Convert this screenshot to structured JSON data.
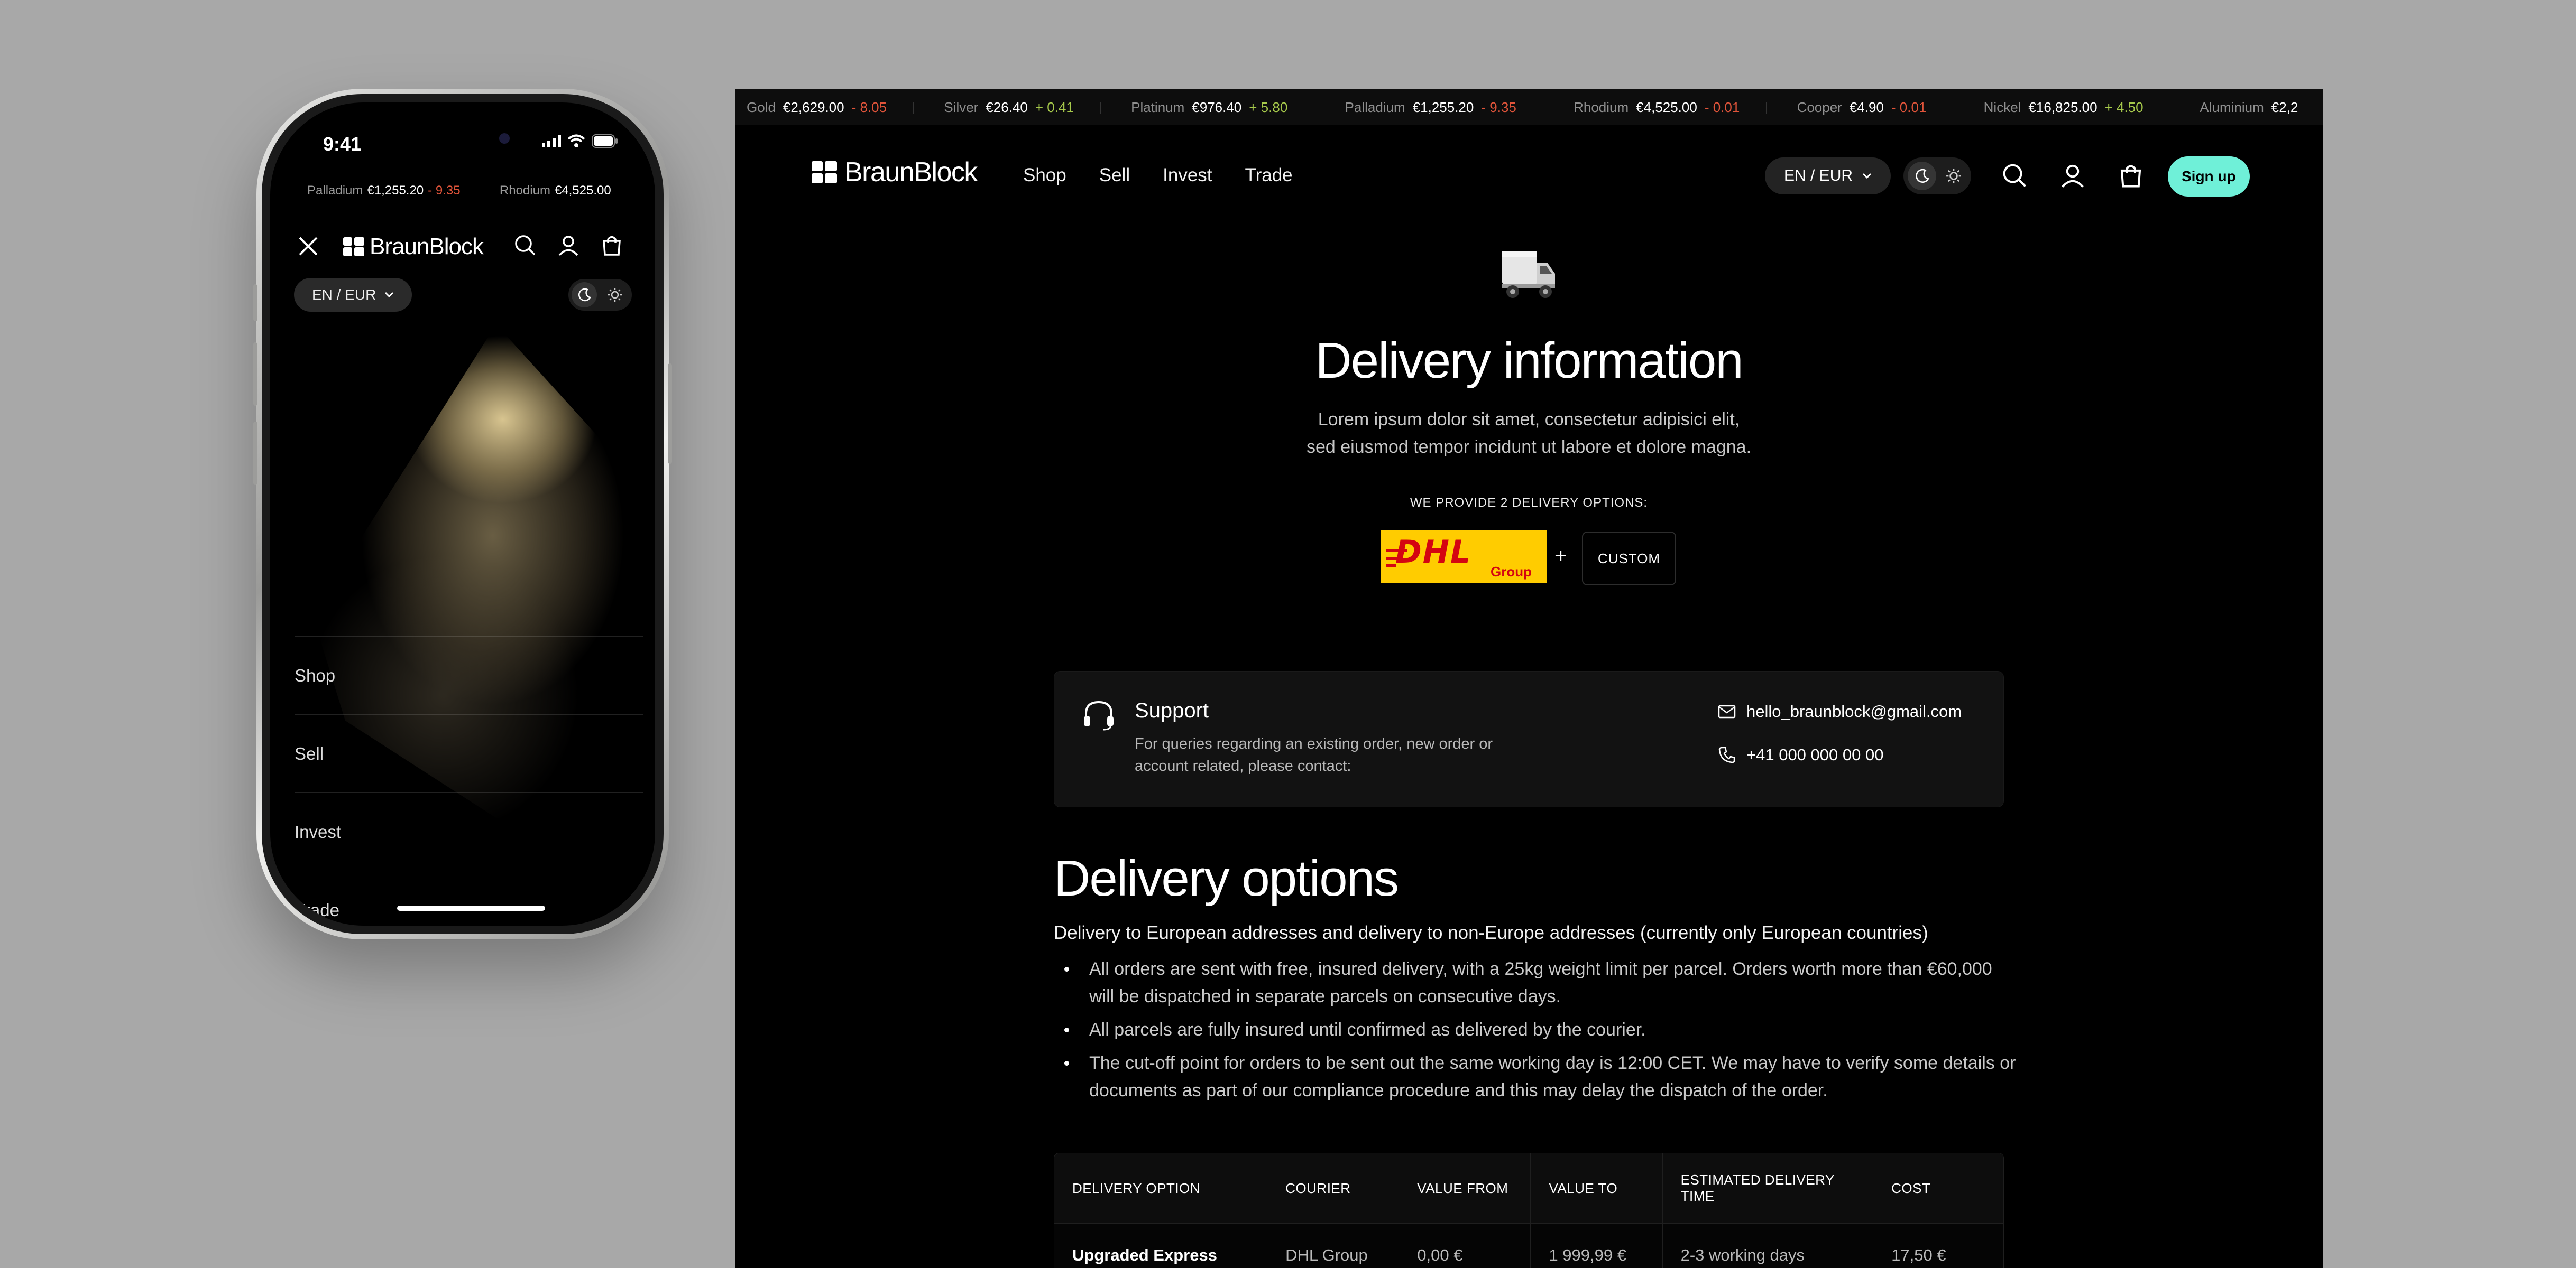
{
  "brand": "BraunBlock",
  "phone": {
    "time": "9:41",
    "ticker": [
      {
        "name": "Palladium",
        "price": "€1,255.20",
        "change": "- 9.35"
      },
      {
        "name": "Rhodium",
        "price": "€4,525.00",
        "change": ""
      }
    ],
    "lang": "EN / EUR",
    "menu": [
      "Shop",
      "Sell",
      "Invest",
      "Trade"
    ]
  },
  "ticker": [
    {
      "name": "Gold",
      "price": "€2,629.00",
      "change": "- 8.05",
      "dir": "down"
    },
    {
      "name": "Silver",
      "price": "€26.40",
      "change": "+ 0.41",
      "dir": "up"
    },
    {
      "name": "Platinum",
      "price": "€976.40",
      "change": "+ 5.80",
      "dir": "up"
    },
    {
      "name": "Palladium",
      "price": "€1,255.20",
      "change": "- 9.35",
      "dir": "down"
    },
    {
      "name": "Rhodium",
      "price": "€4,525.00",
      "change": "- 0.01",
      "dir": "down"
    },
    {
      "name": "Cooper",
      "price": "€4.90",
      "change": "- 0.01",
      "dir": "down"
    },
    {
      "name": "Nickel",
      "price": "€16,825.00",
      "change": "+ 4.50",
      "dir": "up"
    },
    {
      "name": "Aluminium",
      "price": "€2,2",
      "change": "",
      "dir": ""
    }
  ],
  "nav": {
    "links": [
      "Shop",
      "Sell",
      "Invest",
      "Trade"
    ],
    "lang": "EN / EUR",
    "signup": "Sign up"
  },
  "hero": {
    "title": "Delivery information",
    "lead": [
      "Lorem ipsum dolor sit amet, consectetur adipisici elit,",
      "sed eiusmod tempor incidunt ut labore et dolore magna."
    ],
    "options_label": "WE PROVIDE 2 DELIVERY OPTIONS:",
    "dhl_mark": "DHL",
    "dhl_group": "Group",
    "plus": "+",
    "custom": "CUSTOM"
  },
  "support": {
    "title": "Support",
    "desc": "For queries regarding an existing order, new order or account related, please contact:",
    "email": "hello_braunblock@gmail.com",
    "phone": "+41 000 000 00 00"
  },
  "options": {
    "title": "Delivery options",
    "subtitle": "Delivery to European addresses and delivery to non-Europe addresses (currently only European countries)",
    "bullets": [
      "All orders are sent with free, insured delivery, with a 25kg weight limit per parcel. Orders worth more than €60,000 will be dispatched in separate parcels on consecutive days.",
      "All parcels are fully insured until confirmed as delivered by the courier.",
      "The cut-off point for orders to be sent out the same working day is 12:00 CET. We may have to verify some details or documents as part of our compliance procedure and this may delay the dispatch of the order."
    ]
  },
  "table": {
    "headers": [
      "DELIVERY OPTION",
      "COURIER",
      "VALUE FROM",
      "VALUE TO",
      "ESTIMATED DELIVERY TIME",
      "COST"
    ],
    "rows": [
      [
        "Upgraded Express",
        "DHL Group",
        "0,00 €",
        "1 999,99 €",
        "2-3 working days",
        "17,50 €"
      ]
    ]
  },
  "colors": {
    "accent": "#6ff0d8",
    "up": "#a6c94b",
    "down": "#e0543a",
    "dhl_yellow": "#ffcc00",
    "dhl_red": "#d40511"
  }
}
